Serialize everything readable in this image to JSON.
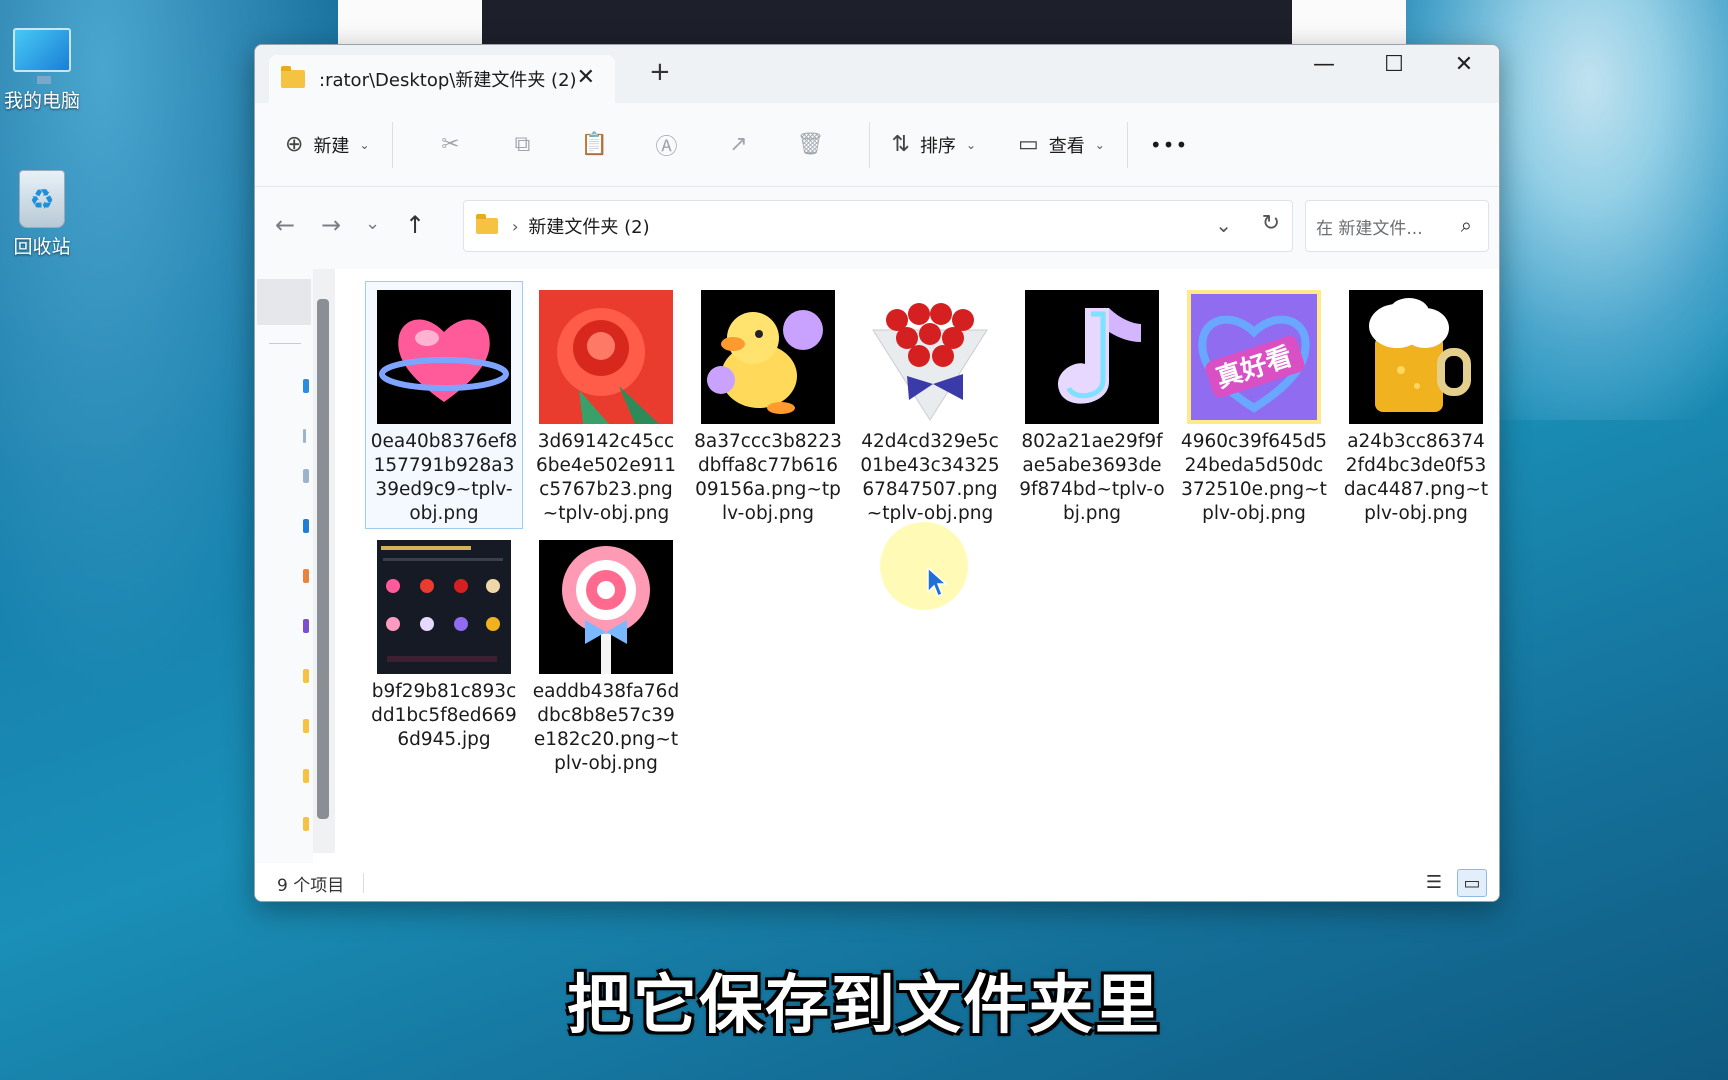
{
  "desktop": {
    "icons": [
      {
        "label": "我的电脑"
      },
      {
        "label": "回收站"
      }
    ]
  },
  "window": {
    "tab_title": ":rator\\Desktop\\新建文件夹 (2)",
    "tab_close": "✕",
    "new_tab": "+",
    "minimize": "—",
    "maximize": "☐",
    "close": "✕"
  },
  "toolbar": {
    "new_label": "新建",
    "sort_label": "排序",
    "view_label": "查看",
    "more": "•••"
  },
  "address": {
    "path": "新建文件夹 (2)",
    "search_placeholder": "在 新建文件..."
  },
  "files": [
    {
      "name": "0ea40b8376ef8157791b928a339ed9c9~tplv-obj.png",
      "thumb": "heart"
    },
    {
      "name": "3d69142c45cc6be4e502e911c5767b23.png~tplv-obj.png",
      "thumb": "rose"
    },
    {
      "name": "8a37ccc3b8223dbffa8c77b61609156a.png~tplv-obj.png",
      "thumb": "duck"
    },
    {
      "name": "42d4cd329e5c01be43c3432567847507.png~tplv-obj.png",
      "thumb": "bouquet"
    },
    {
      "name": "802a21ae29f9fae5abe3693de9f874bd~tplv-obj.png",
      "thumb": "note"
    },
    {
      "name": "4960c39f645d524beda5d50dc372510e.png~tplv-obj.png",
      "thumb": "zhenhaokan"
    },
    {
      "name": "a24b3cc863742fd4bc3de0f53dac4487.png~tplv-obj.png",
      "thumb": "beer"
    },
    {
      "name": "b9f29b81c893cdd1bc5f8ed6696d945.jpg",
      "thumb": "screenshot"
    },
    {
      "name": "eaddb438fa76ddbc8b8e57c39e182c20.png~tplv-obj.png",
      "thumb": "lollipop"
    }
  ],
  "status": {
    "count": "9 个项目"
  },
  "subtitle": "把它保存到文件夹里",
  "colors": {
    "accent": "#0067c0",
    "selection_border": "#9fcdf0",
    "folder": "#f5c242"
  }
}
